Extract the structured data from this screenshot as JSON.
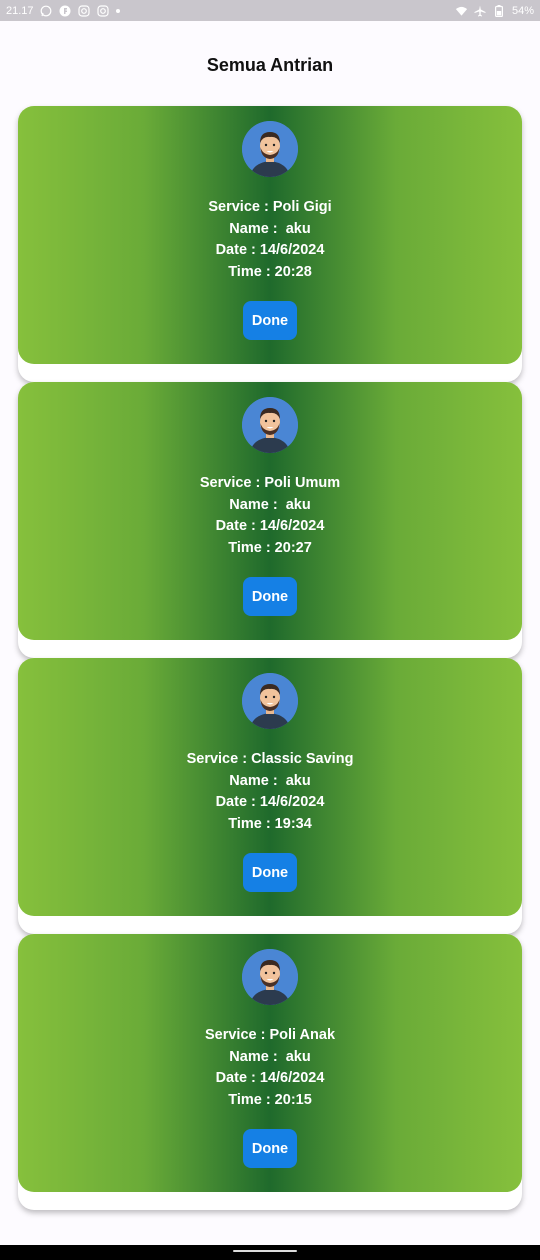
{
  "status_bar": {
    "time": "21.17",
    "battery": "54%",
    "icons": [
      "whatsapp-icon",
      "app-icon",
      "instagram-icon",
      "instagram-icon",
      "dot-icon",
      "wifi-icon",
      "airplane-icon",
      "battery-icon"
    ]
  },
  "header": {
    "title": "Semua Antrian"
  },
  "queue": [
    {
      "service": "Service : Poli Gigi",
      "name": "Name :  aku",
      "date": "Date : 14/6/2024",
      "time": "Time : 20:28",
      "button": "Done"
    },
    {
      "service": "Service : Poli Umum",
      "name": "Name :  aku",
      "date": "Date : 14/6/2024",
      "time": "Time : 20:27",
      "button": "Done"
    },
    {
      "service": "Service : Classic Saving",
      "name": "Name :  aku",
      "date": "Date : 14/6/2024",
      "time": "Time : 19:34",
      "button": "Done"
    },
    {
      "service": "Service : Poli Anak",
      "name": "Name :  aku",
      "date": "Date : 14/6/2024",
      "time": "Time : 20:15",
      "button": "Done"
    }
  ],
  "colors": {
    "card_gradient_edge": "#86c03c",
    "card_gradient_center": "#1f6a2c",
    "button": "#1580e5",
    "avatar_bg": "#4a86d4"
  }
}
